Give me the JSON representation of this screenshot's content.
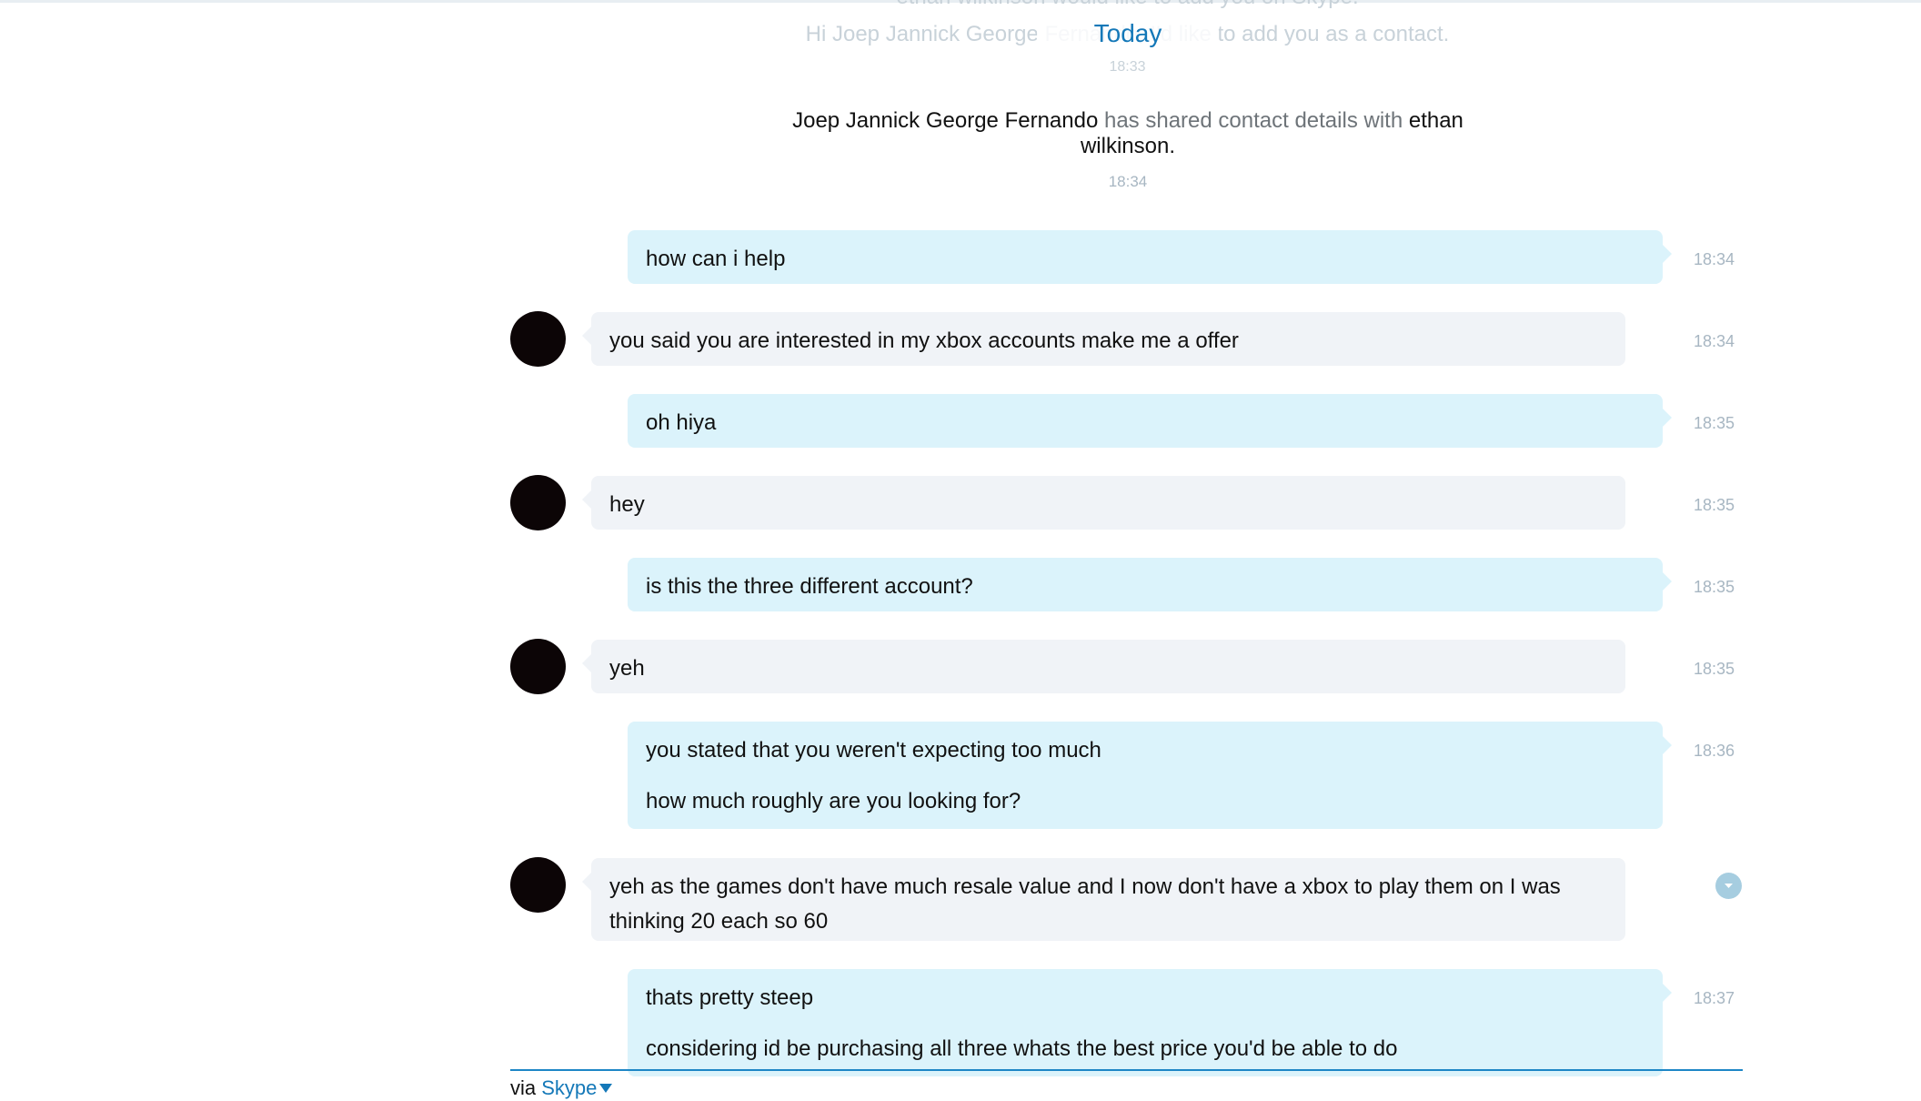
{
  "header": {
    "today_label": "Today",
    "faded_request_title": "ethan wilkinson would like to add you on Skype.",
    "faded_request_text": "Hi Joep Jannick George Fernando, I'd like to add you as a contact.",
    "faded_request_time": "18:33"
  },
  "system_event": {
    "actor": "Joep Jannick George Fernando",
    "action": "has shared contact details with",
    "target": "ethan wilkinson.",
    "time": "18:34"
  },
  "messages": [
    {
      "direction": "outgoing",
      "paragraphs": [
        "how can i help"
      ],
      "time": "18:34"
    },
    {
      "direction": "incoming",
      "paragraphs": [
        "you said you are interested in my xbox accounts make me a offer"
      ],
      "time": "18:34"
    },
    {
      "direction": "outgoing",
      "paragraphs": [
        "oh hiya"
      ],
      "time": "18:35"
    },
    {
      "direction": "incoming",
      "paragraphs": [
        "hey"
      ],
      "time": "18:35"
    },
    {
      "direction": "outgoing",
      "paragraphs": [
        "is this the three different account?"
      ],
      "time": "18:35"
    },
    {
      "direction": "incoming",
      "paragraphs": [
        "yeh"
      ],
      "time": "18:35"
    },
    {
      "direction": "outgoing",
      "paragraphs": [
        "you stated that you weren't expecting too much",
        "how much roughly are you looking for?"
      ],
      "time": "18:36"
    },
    {
      "direction": "incoming",
      "paragraphs": [
        "yeh as the games don't have much resale value and I now don't have a xbox to play them on I was thinking 20 each so 60"
      ],
      "time": ""
    },
    {
      "direction": "outgoing",
      "paragraphs": [
        "thats pretty steep",
        "considering id be purchasing all three whats the best price you'd be able to do"
      ],
      "time": "18:37"
    }
  ],
  "message_options_icon": "chevron-down-icon",
  "footer": {
    "via_label": "via",
    "service_label": "Skype"
  },
  "colors": {
    "accent": "#1478b8",
    "outgoing_bubble": "#dbf3fb",
    "incoming_bubble": "#f0f3f7",
    "timestamp": "#a7b6c2",
    "avatar": "#0c0506"
  }
}
